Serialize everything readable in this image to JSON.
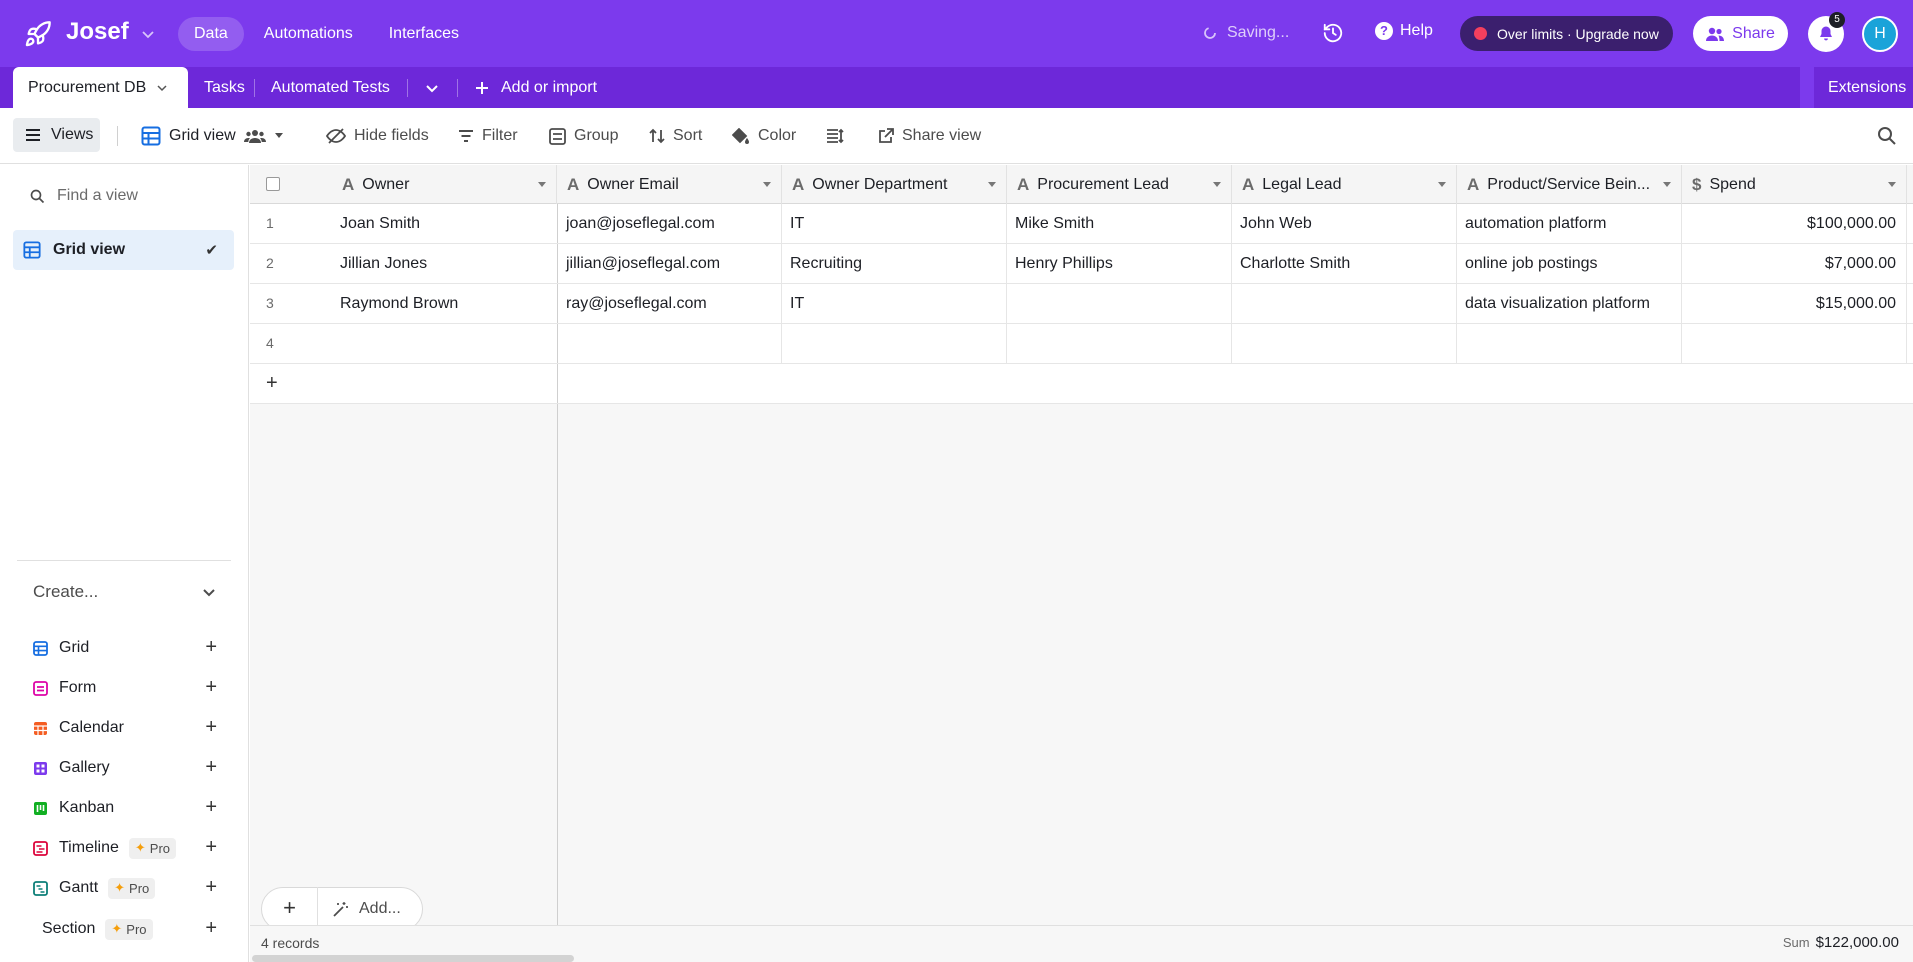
{
  "colors": {
    "topbar": "#7c3aed",
    "tabbar": "#6d28d9",
    "accent_red": "#f43f5e",
    "avatar": "#1aa3d9",
    "selected_view_bg": "#e6f0fb"
  },
  "app": {
    "name": "Josef"
  },
  "topnav": {
    "items": [
      "Data",
      "Automations",
      "Interfaces"
    ],
    "active": "Data"
  },
  "status": {
    "saving": "Saving..."
  },
  "help_label": "Help",
  "limits_label": "Over limits · Upgrade now",
  "share_label": "Share",
  "notifications": {
    "count": "5"
  },
  "user": {
    "initial": "H"
  },
  "tabs": {
    "active": "Procurement DB",
    "others": [
      "Tasks",
      "Automated Tests"
    ],
    "add_import": "Add or import",
    "extensions": "Extensions"
  },
  "toolbar": {
    "views": "Views",
    "grid_view": "Grid view",
    "hide_fields": "Hide fields",
    "filter": "Filter",
    "group": "Group",
    "sort": "Sort",
    "color": "Color",
    "share_view": "Share view"
  },
  "sidebar": {
    "find_placeholder": "Find a view",
    "selected_view": "Grid view",
    "create_label": "Create...",
    "create_items": [
      {
        "label": "Grid",
        "icon": "grid-icon",
        "color": "#166ee1",
        "pro": false
      },
      {
        "label": "Form",
        "icon": "form-icon",
        "color": "#dd04a8",
        "pro": false
      },
      {
        "label": "Calendar",
        "icon": "calendar-icon",
        "color": "#f45d22",
        "pro": false
      },
      {
        "label": "Gallery",
        "icon": "gallery-icon",
        "color": "#7c3aed",
        "pro": false
      },
      {
        "label": "Kanban",
        "icon": "kanban-icon",
        "color": "#11af22",
        "pro": false
      },
      {
        "label": "Timeline",
        "icon": "timeline-icon",
        "color": "#dc043b",
        "pro": true
      },
      {
        "label": "Gantt",
        "icon": "gantt-icon",
        "color": "#0d7f78",
        "pro": true
      },
      {
        "label": "Section",
        "icon": "",
        "color": "",
        "pro": true
      }
    ],
    "pro_label": "Pro"
  },
  "grid": {
    "columns": [
      "Owner",
      "Owner Email",
      "Owner Department",
      "Procurement Lead",
      "Legal Lead",
      "Product/Service Bein...",
      "Spend"
    ],
    "rows": [
      {
        "num": "1",
        "cells": [
          "Joan Smith",
          "joan@joseflegal.com",
          "IT",
          "Mike Smith",
          "John Web",
          "automation platform",
          "$100,000.00"
        ]
      },
      {
        "num": "2",
        "cells": [
          "Jillian Jones",
          "jillian@joseflegal.com",
          "Recruiting",
          "Henry Phillips",
          "Charlotte Smith",
          "online job postings",
          "$7,000.00"
        ]
      },
      {
        "num": "3",
        "cells": [
          "Raymond Brown",
          "ray@joseflegal.com",
          "IT",
          "",
          "",
          "data visualization platform",
          "$15,000.00"
        ]
      },
      {
        "num": "4",
        "cells": [
          "",
          "",
          "",
          "",
          "",
          "",
          ""
        ]
      }
    ],
    "add_label": "Add...",
    "records": "4 records",
    "sum_label": "Sum",
    "sum_value": "$122,000.00"
  }
}
